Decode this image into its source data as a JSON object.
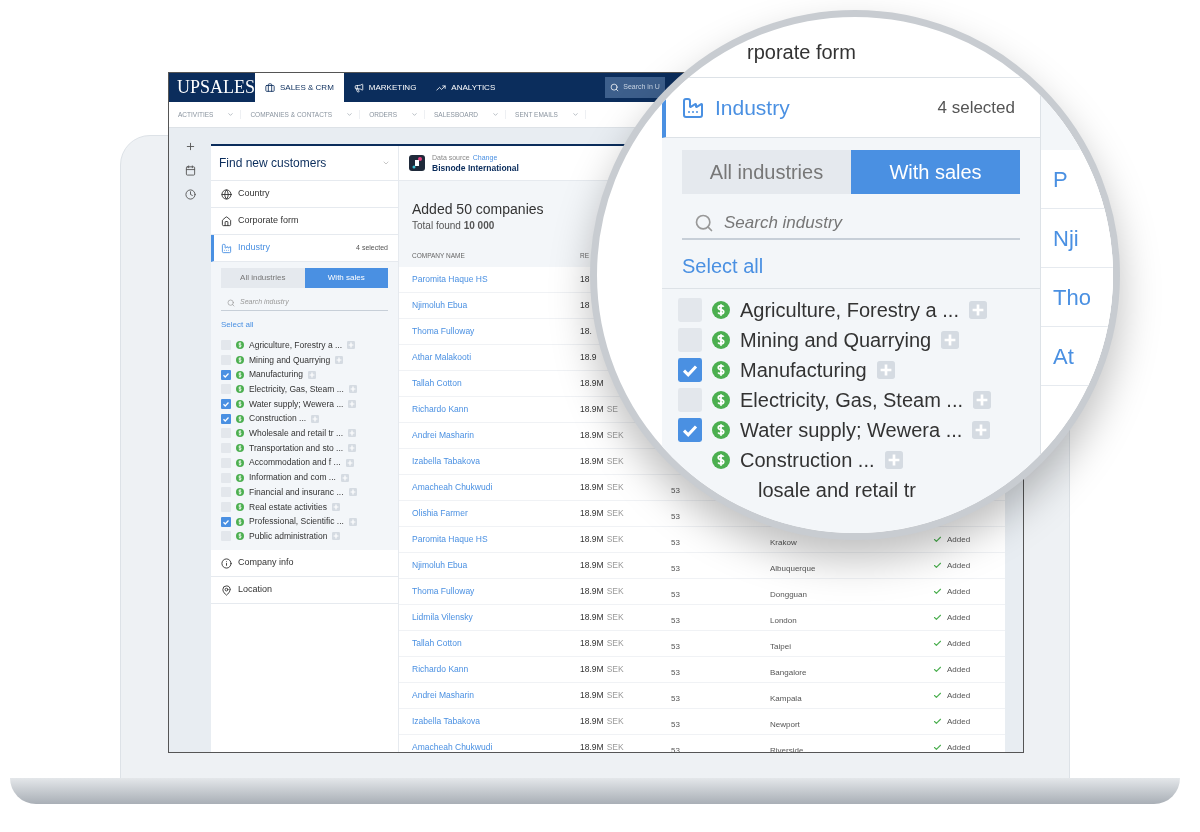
{
  "nav": {
    "logo": "UPSALES",
    "tabs": [
      {
        "label": "SALES & CRM",
        "selected": true
      },
      {
        "label": "MARKETING",
        "selected": false
      },
      {
        "label": "ANALYTICS",
        "selected": false
      }
    ],
    "search": {
      "placeholder": "Search in U"
    }
  },
  "subnav": [
    {
      "label": "ACTIVITIES"
    },
    {
      "label": "COMPANIES & CONTACTS"
    },
    {
      "label": "ORDERS"
    },
    {
      "label": "SALESBOARD"
    },
    {
      "label": "SENT EMAILS"
    }
  ],
  "sidebar": {
    "title": "Find new customers",
    "filters_top": [
      {
        "label": "Country",
        "selected": false
      },
      {
        "label": "Corporate form",
        "selected": false
      },
      {
        "label": "Industry",
        "selected": true,
        "count": "4 selected"
      }
    ],
    "industry_panel": {
      "tabs": [
        {
          "label": "All industries",
          "selected": false
        },
        {
          "label": "With sales",
          "selected": true
        }
      ],
      "search_placeholder": "Search industry",
      "select_all": "Select all",
      "items": [
        {
          "label": "Agriculture, Forestry a ...",
          "checked": false
        },
        {
          "label": "Mining and Quarrying",
          "checked": false
        },
        {
          "label": "Manufacturing",
          "checked": true
        },
        {
          "label": "Electricity, Gas, Steam ...",
          "checked": false
        },
        {
          "label": "Water supply; Wewera ...",
          "checked": true
        },
        {
          "label": "Construction ...",
          "checked": true
        },
        {
          "label": "Wholesale and retail tr ...",
          "checked": false
        },
        {
          "label": "Transportation and sto ...",
          "checked": false
        },
        {
          "label": "Accommodation and f ...",
          "checked": false
        },
        {
          "label": "Information and com ...",
          "checked": false
        },
        {
          "label": "Financial and insuranc ...",
          "checked": false
        },
        {
          "label": "Real estate activities",
          "checked": false
        },
        {
          "label": "Professional, Scientific ...",
          "checked": true
        },
        {
          "label": "Public administration",
          "checked": false
        }
      ]
    },
    "filters_bottom": [
      {
        "label": "Company info",
        "selected": false
      },
      {
        "label": "Location",
        "selected": false
      }
    ]
  },
  "results": {
    "source_label": "Data source",
    "change_link": "Change",
    "source_name": "Bisnode International",
    "heading": "Added 50 companies",
    "total": "Total found **10 000**",
    "columns": [
      "COMPANY NAME",
      "RE"
    ],
    "rows": [
      {
        "name": "Paromita Haque HS",
        "revenue": "18"
      },
      {
        "name": "Njimoluh Ebua",
        "revenue": "18"
      },
      {
        "name": "Thoma Fulloway",
        "revenue": "18."
      },
      {
        "name": "Athar Malakooti",
        "revenue": "18.9"
      },
      {
        "name": "Tallah Cotton",
        "revenue": "18.9M"
      },
      {
        "name": "Richardo Kann",
        "revenue": "18.9M",
        "currency": "SE"
      },
      {
        "name": "Andrei Masharin",
        "revenue": "18.9M",
        "currency": "SEK"
      },
      {
        "name": "Izabella Tabakova",
        "revenue": "18.9M",
        "currency": "SEK"
      },
      {
        "name": "Amacheah Chukwudi",
        "revenue": "18.9M",
        "currency": "SEK",
        "employees": "53"
      },
      {
        "name": "Olishia Farmer",
        "revenue": "18.9M",
        "currency": "SEK",
        "employees": "53"
      },
      {
        "name": "Paromita Haque HS",
        "revenue": "18.9M",
        "currency": "SEK",
        "employees": "53",
        "city": "Krakow",
        "status": "Added"
      },
      {
        "name": "Njimoluh Ebua",
        "revenue": "18.9M",
        "currency": "SEK",
        "employees": "53",
        "city": "Albuquerque",
        "status": "Added"
      },
      {
        "name": "Thoma Fulloway",
        "revenue": "18.9M",
        "currency": "SEK",
        "employees": "53",
        "city": "Dongguan",
        "status": "Added"
      },
      {
        "name": "Lidmila Vilensky",
        "revenue": "18.9M",
        "currency": "SEK",
        "employees": "53",
        "city": "London",
        "status": "Added"
      },
      {
        "name": "Tallah Cotton",
        "revenue": "18.9M",
        "currency": "SEK",
        "employees": "53",
        "city": "Taipei",
        "status": "Added"
      },
      {
        "name": "Richardo Kann",
        "revenue": "18.9M",
        "currency": "SEK",
        "employees": "53",
        "city": "Bangalore",
        "status": "Added"
      },
      {
        "name": "Andrei Masharin",
        "revenue": "18.9M",
        "currency": "SEK",
        "employees": "53",
        "city": "Kampala",
        "status": "Added"
      },
      {
        "name": "Izabella Tabakova",
        "revenue": "18.9M",
        "currency": "SEK",
        "employees": "53",
        "city": "Newport",
        "status": "Added"
      },
      {
        "name": "Amacheah Chukwudi",
        "revenue": "18.9M",
        "currency": "SEK",
        "employees": "53",
        "city": "Riverside",
        "status": "Added"
      }
    ]
  },
  "magnifier": {
    "corporate_form": "rporate form",
    "industry": {
      "label": "Industry",
      "selected": true,
      "count": "4 selected"
    },
    "tabs": [
      {
        "label": "All industries",
        "selected": false
      },
      {
        "label": "With sales",
        "selected": true
      }
    ],
    "search_placeholder": "Search industry",
    "select_all": "Select all",
    "items": [
      {
        "label": "Agriculture, Forestry a ...",
        "checked": false
      },
      {
        "label": "Mining and Quarrying",
        "checked": false
      },
      {
        "label": "Manufacturing",
        "checked": true
      },
      {
        "label": "Electricity, Gas, Steam ...",
        "checked": false
      },
      {
        "label": "Water supply; Wewera ...",
        "checked": true
      },
      {
        "label": "Construction ..."
      }
    ],
    "item_fragment": "losale and retail tr",
    "row_fragments": [
      "P",
      "Nji",
      "Tho",
      "At"
    ]
  }
}
